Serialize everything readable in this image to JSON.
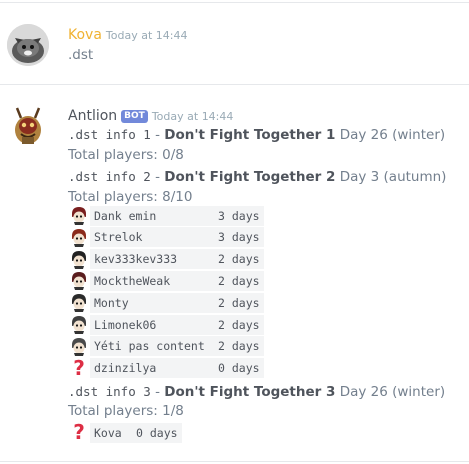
{
  "messages": [
    {
      "author": "Kova",
      "author_color": "#f0b232",
      "timestamp": "Today at 14:44",
      "avatar_icon": "cat-avatar-icon",
      "text": ".dst"
    },
    {
      "author": "Antlion",
      "author_color": "#4f545c",
      "bot_tag": "BOT",
      "timestamp": "Today at 14:44",
      "avatar_icon": "antlion-avatar-icon",
      "servers": [
        {
          "cmd": ".dst info 1",
          "sep": " - ",
          "name": "Don't Fight Together 1",
          "day": " Day 26 (winter)",
          "total": "Total players: 0/8",
          "players": []
        },
        {
          "cmd": ".dst info 2",
          "sep": " - ",
          "name": "Don't Fight Together 2",
          "day": " Day 3 (autumn)",
          "total": "Total players: 8/10",
          "players": [
            {
              "name": "Dank emin",
              "days": "3 days",
              "icon": "character-head-icon"
            },
            {
              "name": "Strelok",
              "days": "3 days",
              "icon": "character-head-icon"
            },
            {
              "name": "kev333kev333",
              "days": "2 days",
              "icon": "character-head-icon"
            },
            {
              "name": "MocktheWeak",
              "days": "2 days",
              "icon": "character-head-icon"
            },
            {
              "name": "Monty",
              "days": "2 days",
              "icon": "character-head-icon"
            },
            {
              "name": "Limonek06",
              "days": "2 days",
              "icon": "character-head-icon"
            },
            {
              "name": "Yéti pas content",
              "days": "2 days",
              "icon": "character-head-icon"
            },
            {
              "name": "dzinzilya",
              "days": "0 days",
              "icon": "question-mark-icon"
            }
          ]
        },
        {
          "cmd": ".dst info 3",
          "sep": " - ",
          "name": "Don't Fight Together 3",
          "day": " Day 26 (winter)",
          "total": "Total players: 1/8",
          "players": [
            {
              "name": "Kova",
              "days": "0 days",
              "icon": "question-mark-icon"
            }
          ]
        }
      ]
    }
  ]
}
